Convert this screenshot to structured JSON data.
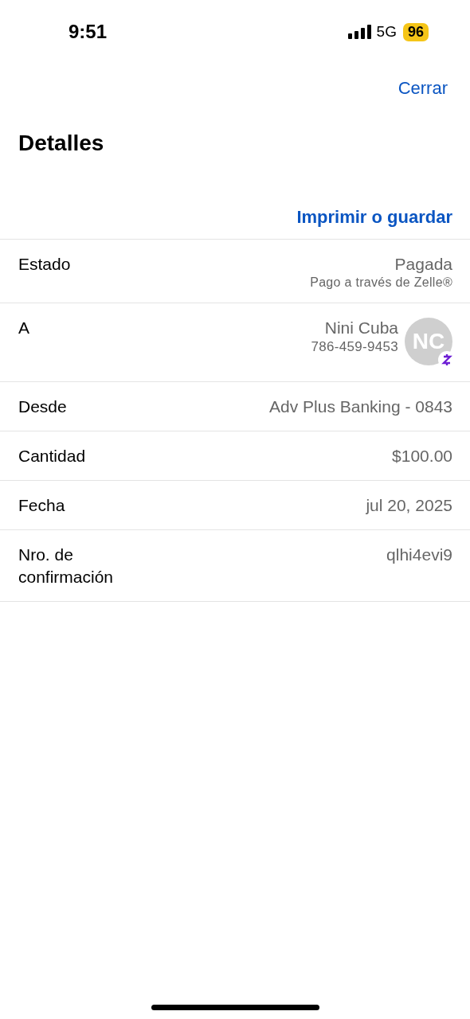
{
  "status_bar": {
    "time": "9:51",
    "network": "5G",
    "battery": "96"
  },
  "close_button": "Cerrar",
  "title": "Detalles",
  "print_link": "Imprimir o guardar",
  "rows": [
    {
      "kind": "status",
      "label": "Estado",
      "value": "Pagada",
      "subtitle": "Pago a través de Zelle®"
    },
    {
      "kind": "contact",
      "label": "A",
      "value": "Nini Cuba",
      "subtitle": "786-459-9453",
      "initials": "NC"
    },
    {
      "kind": "plain",
      "label": "Desde",
      "value": "Adv Plus Banking - 0843"
    },
    {
      "kind": "plain",
      "label": "Cantidad",
      "value": "$100.00"
    },
    {
      "kind": "plain",
      "label": "Fecha",
      "value": "jul 20, 2025"
    },
    {
      "kind": "plain",
      "label": "Nro. de confirmación",
      "value": "qlhi4evi9"
    }
  ]
}
